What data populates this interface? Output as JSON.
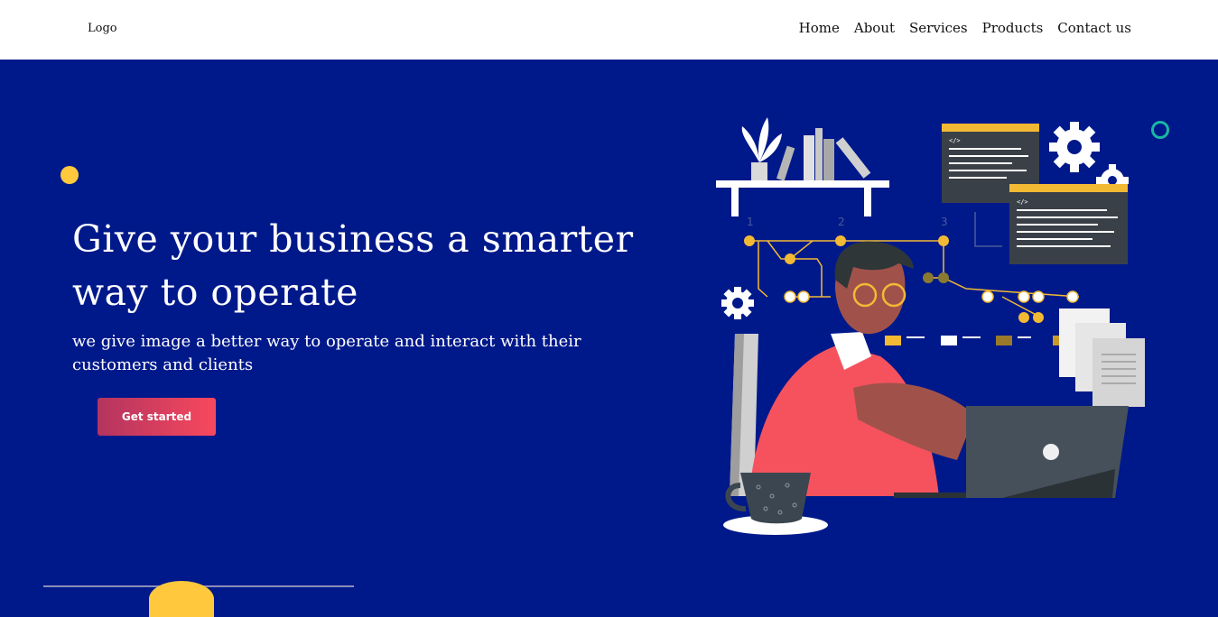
{
  "header": {
    "logo": "Logo",
    "nav": [
      "Home",
      "About",
      "Services",
      "Products",
      "Contact us"
    ]
  },
  "hero": {
    "title": "Give your business a smarter way to operate",
    "subtitle": "we give image a better way to operate and interact with their customers and clients",
    "cta_label": "Get started",
    "illustration_step_labels": [
      "1",
      "2",
      "3"
    ],
    "code_window_tags": [
      "</>",
      "</>"
    ]
  },
  "colors": {
    "hero_background": "#00198a",
    "accent_yellow": "#ffc83d",
    "accent_teal": "#19b6a2",
    "cta_gradient_start": "#b3345f",
    "cta_gradient_end": "#f8485e"
  }
}
